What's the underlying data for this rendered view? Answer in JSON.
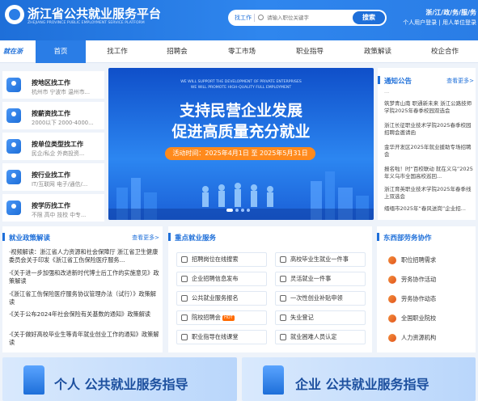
{
  "header": {
    "title": "浙江省公共就业服务平台",
    "subtitle": "ZHEJIANG PROVINCE PUBLIC EMPLOYMENT SERVICE PLATFORM",
    "search_type": "找工作",
    "search_placeholder": "请输入职位关键字",
    "search_button": "搜索",
    "top_links": "浙/江/政/务/服/务",
    "user_links": "个人用户登录 | 用人单位登录"
  },
  "nav": {
    "brand": "就在浙",
    "items": [
      "首页",
      "找工作",
      "招聘会",
      "零工市场",
      "职业指导",
      "政策解读",
      "校企合作"
    ]
  },
  "categories": [
    {
      "title": "按地区找工作",
      "sub": "杭州市 宁波市 温州市..."
    },
    {
      "title": "按薪资找工作",
      "sub": "2000以下 2000-4000..."
    },
    {
      "title": "按单位类型找工作",
      "sub": "民企/私企 外商投资..."
    },
    {
      "title": "按行业找工作",
      "sub": "IT/互联网 电子/通信/..."
    },
    {
      "title": "按学历找工作",
      "sub": "不限 高中 技校 中专..."
    }
  ],
  "banner": {
    "en_line1": "WE WILL SUPPORT THE DEVELOPMENT OF PRIVATE ENTERPRISES",
    "en_line2": "WE WILL PROMOTE HIGH-QUALITY FULL EMPLOYMENT",
    "title1": "支持民营企业发展",
    "title2": "促进高质量充分就业",
    "date": "活动时间：2025年4月1日 至 2025年5月31日"
  },
  "notice": {
    "title": "通知公告",
    "more": "查看更多>",
    "items": [
      "...",
      "筑梦青山南 职通新未来 浙江公路技师学院2025年春季校园双选会",
      "浙江长征职业技术学院2025春季校园招聘会邀请函",
      "金华开发区2025年就业援助专场招聘会",
      "报名啦！时“百校联动 就在义乌”2025年义乌市全国高校巡回...",
      "浙江育英职业技术学院2025年春季线上双选会",
      "缙缅市2025年“春风送岗”企业招..."
    ]
  },
  "policy": {
    "title": "就业政策解读",
    "more": "查看更多>",
    "items": [
      "·视频解读：浙江省人力资源和社会保障厅 浙江省卫生健康委员会关于印发《浙江省工伤保险医疗服务...",
      "·《关于进一步加强和改进新时代博士后工作的实施意见》政策解读",
      "·《浙江省工伤保险医疗服务协议管理办法（试行）》政策解读",
      "·《关于公布2024年社会保险有关基数的通知》政策解读",
      "·《关于做好高校毕业生等青年就业创业工作的通知》政策解读"
    ]
  },
  "key_services": {
    "title": "重点就业服务",
    "items": [
      "招聘岗位在线搜索",
      "高校毕业生就业一件事",
      "企业招聘信息发布",
      "灵活就业一件事",
      "公共就业服务报名",
      "一次性创业补贴申领",
      "院校招聘会",
      "失业登记",
      "职业指导在线课堂",
      "就业困难人员认定"
    ],
    "hot_label": "HOT"
  },
  "east_west": {
    "title": "东西部劳务协作",
    "items": [
      "职位招聘需求",
      "劳务协作活动",
      "劳务协作动态",
      "全国职业院校",
      "人力资源机构"
    ]
  },
  "guides": {
    "personal": "个人 公共就业服务指导",
    "enterprise": "企业 公共就业服务指导"
  },
  "colors": {
    "primary": "#1e6fd9",
    "accent": "#ff8a1c",
    "background": "#eef3fa"
  }
}
